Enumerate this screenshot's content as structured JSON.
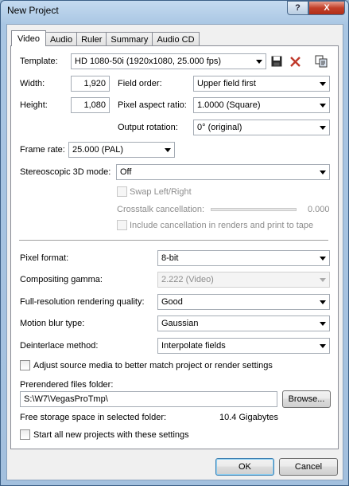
{
  "window": {
    "title": "New Project",
    "help_label": "?",
    "close_label": "X"
  },
  "tabs": [
    {
      "label": "Video"
    },
    {
      "label": "Audio"
    },
    {
      "label": "Ruler"
    },
    {
      "label": "Summary"
    },
    {
      "label": "Audio CD"
    }
  ],
  "video": {
    "template_label": "Template:",
    "template_value": "HD 1080-50i (1920x1080, 25.000 fps)",
    "width_label": "Width:",
    "width_value": "1,920",
    "height_label": "Height:",
    "height_value": "1,080",
    "field_order_label": "Field order:",
    "field_order_value": "Upper field first",
    "pixel_aspect_label": "Pixel aspect ratio:",
    "pixel_aspect_value": "1.0000 (Square)",
    "output_rotation_label": "Output rotation:",
    "output_rotation_value": "0° (original)",
    "frame_rate_label": "Frame rate:",
    "frame_rate_value": "25.000 (PAL)",
    "stereo_label": "Stereoscopic 3D mode:",
    "stereo_value": "Off",
    "swap_label": "Swap Left/Right",
    "crosstalk_label": "Crosstalk cancellation:",
    "crosstalk_value": "0.000",
    "include_cancel_label": "Include cancellation in renders and print to tape",
    "pixel_format_label": "Pixel format:",
    "pixel_format_value": "8-bit",
    "gamma_label": "Compositing gamma:",
    "gamma_value": "2.222 (Video)",
    "quality_label": "Full-resolution rendering quality:",
    "quality_value": "Good",
    "motion_blur_label": "Motion blur type:",
    "motion_blur_value": "Gaussian",
    "deinterlace_label": "Deinterlace method:",
    "deinterlace_value": "Interpolate fields",
    "adjust_source_label": "Adjust source media to better match project or render settings",
    "prerender_label": "Prerendered files folder:",
    "prerender_path": "S:\\W7\\VegasProTmp\\",
    "browse_label": "Browse...",
    "free_space_label": "Free storage space in selected folder:",
    "free_space_value": "10.4 Gigabytes",
    "start_all_label": "Start all new projects with these settings"
  },
  "footer": {
    "ok_label": "OK",
    "cancel_label": "Cancel"
  },
  "colors": {
    "accent": "#3c7fb1",
    "close_button": "#c2402a",
    "title_bar": "#a9c6e3"
  },
  "icons": [
    "save-icon",
    "delete-icon",
    "copy-icon"
  ]
}
